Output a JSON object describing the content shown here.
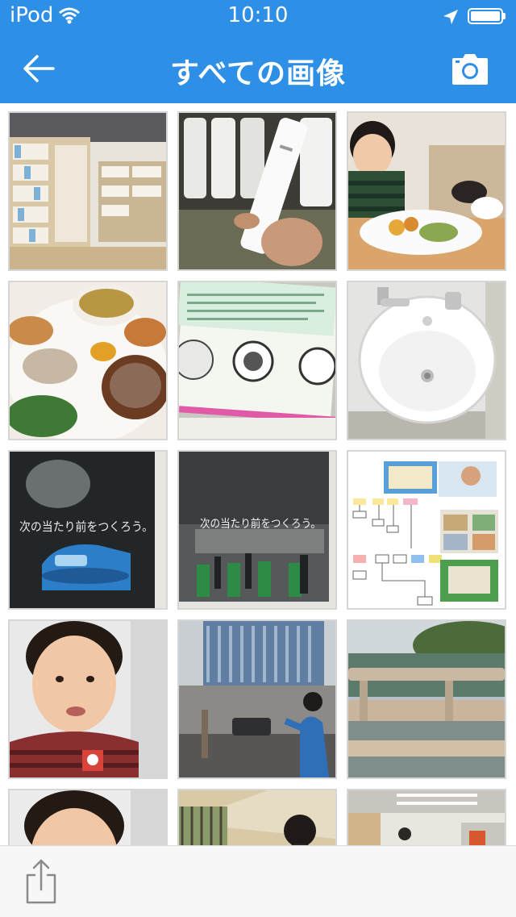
{
  "status_bar": {
    "carrier": "iPod",
    "time": "10:10",
    "battery_level": 1.0
  },
  "header": {
    "title": "すべての画像",
    "accent_color": "#2e8fe6"
  },
  "icons": {
    "wifi": "wifi-icon",
    "location": "location-arrow-icon",
    "battery": "battery-icon",
    "back": "back-arrow-icon",
    "camera": "camera-icon",
    "share": "share-icon"
  },
  "photos": [
    {
      "name": "bookstore-shelves"
    },
    {
      "name": "cream-tubes"
    },
    {
      "name": "child-eating-lunch"
    },
    {
      "name": "food-plate"
    },
    {
      "name": "emblems-poster"
    },
    {
      "name": "wash-basin"
    },
    {
      "name": "train-poster",
      "caption": "次の当たり前をつくろう。"
    },
    {
      "name": "station-gates-poster",
      "caption": "次の当たり前をつくろう。"
    },
    {
      "name": "ui-flow-diagram"
    },
    {
      "name": "boy-portrait"
    },
    {
      "name": "street-buildings"
    },
    {
      "name": "river-bridge"
    },
    {
      "name": "boy-portrait-2"
    },
    {
      "name": "child-outdoors"
    },
    {
      "name": "office-interior"
    }
  ]
}
